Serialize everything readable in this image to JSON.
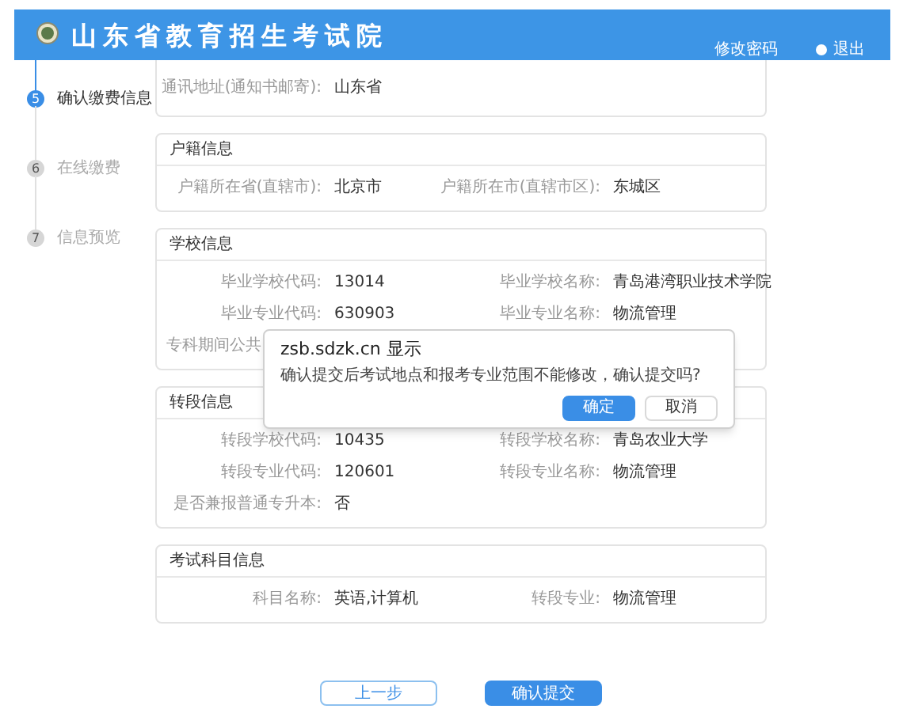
{
  "header": {
    "title": "山东省教育招生考试院",
    "links": [
      {
        "kind": "text",
        "label": "修改密码"
      },
      {
        "kind": "user",
        "label": "退出"
      }
    ]
  },
  "steps": [
    {
      "number": "5",
      "label": "确认缴费信息",
      "selected": true
    },
    {
      "number": "6",
      "label": "在线缴费",
      "selected": false
    },
    {
      "number": "7",
      "label": "信息预览",
      "selected": false
    }
  ],
  "sections": [
    {
      "cut": true,
      "rows": [
        [
          {
            "label": "通讯地址(通知书邮寄):",
            "value": "山东省"
          }
        ]
      ]
    },
    {
      "title": "户籍信息",
      "rows": [
        [
          {
            "label": "户籍所在省(直辖市):",
            "value": "北京市"
          },
          {
            "label": "户籍所在市(直辖市区):",
            "value": "东城区"
          }
        ]
      ]
    },
    {
      "title": "学校信息",
      "rows": [
        [
          {
            "label": "毕业学校代码:",
            "value": "13014"
          },
          {
            "label": "毕业学校名称:",
            "value": "青岛港湾职业技术学院"
          }
        ],
        [
          {
            "label": "毕业专业代码:",
            "value": "630903"
          },
          {
            "label": "毕业专业名称:",
            "value": "物流管理"
          }
        ],
        [
          {
            "label": "专科期间公共"
          }
        ]
      ]
    },
    {
      "title": "转段信息",
      "rows": [
        [
          {
            "label": "转段学校代码:",
            "value": "10435"
          },
          {
            "label": "转段学校名称:",
            "value": "青岛农业大学"
          }
        ],
        [
          {
            "label": "转段专业代码:",
            "value": "120601"
          },
          {
            "label": "转段专业名称:",
            "value": "物流管理"
          }
        ],
        [
          {
            "label": "是否兼报普通专升本:",
            "value": "否"
          }
        ]
      ]
    },
    {
      "title": "考试科目信息",
      "rows": [
        [
          {
            "label": "科目名称:",
            "value": "英语,计算机"
          },
          {
            "label": "转段专业:",
            "value": "物流管理"
          }
        ]
      ]
    }
  ],
  "dialog": {
    "title": "zsb.sdzk.cn 显示",
    "message": "确认提交后考试地点和报考专业范围不能修改，确认提交吗?",
    "buttons": [
      {
        "label": "确定",
        "primary": true
      },
      {
        "label": "取消",
        "primary": false
      }
    ]
  },
  "buttons": [
    {
      "label": "上一步",
      "primary": false
    },
    {
      "label": "确认提交",
      "primary": true
    }
  ]
}
